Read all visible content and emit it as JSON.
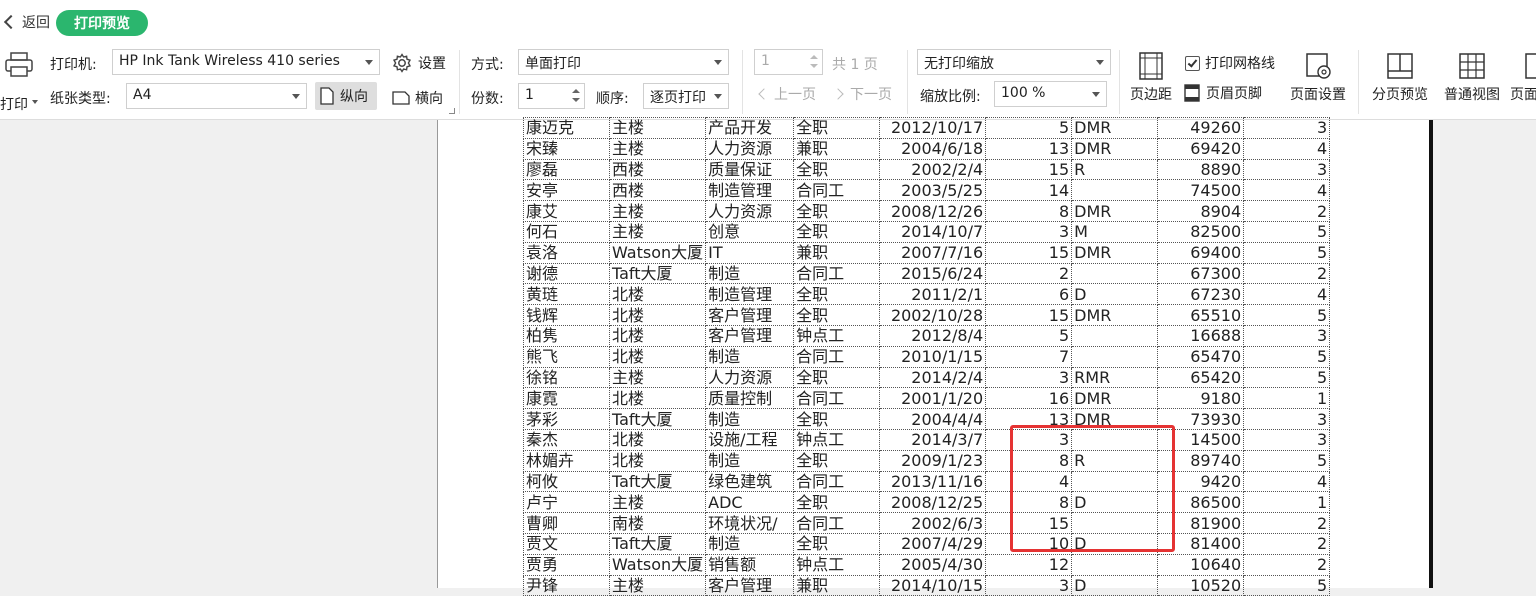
{
  "topbar": {
    "back_label": "返回",
    "mode_label": "打印预览"
  },
  "ribbon": {
    "print_label": "打印",
    "printer_label": "打印机:",
    "printer_value": "HP Ink Tank Wireless 410 series",
    "settings_label": "设置",
    "paper_label": "纸张类型:",
    "paper_value": "A4",
    "portrait_label": "纵向",
    "landscape_label": "横向",
    "method_label": "方式:",
    "method_value": "单面打印",
    "copies_label": "份数:",
    "copies_value": "1",
    "order_label": "顺序:",
    "order_value": "逐页打印",
    "page_value": "1",
    "total_pages": "共 1 页",
    "prev_page": "上一页",
    "next_page": "下一页",
    "scaling_value": "无打印缩放",
    "zoom_label": "缩放比例:",
    "zoom_value": "100 %",
    "margins_label": "页边距",
    "gridlines_label": "打印网格线",
    "header_footer_label": "页眉页脚",
    "page_setup_label": "页面设置",
    "page_break_label": "分页预览",
    "normal_view_label": "普通视图",
    "page_layout_label": "页面"
  },
  "sheet": {
    "rows": [
      [
        "康迈克",
        "主楼",
        "产品开发",
        "全职",
        "2012/10/17",
        "5",
        "DMR",
        "49260",
        "3"
      ],
      [
        "宋臻",
        "主楼",
        "人力资源",
        "兼职",
        "2004/6/18",
        "13",
        "DMR",
        "69420",
        "4"
      ],
      [
        "廖磊",
        "西楼",
        "质量保证",
        "全职",
        "2002/2/4",
        "15",
        "R",
        "8890",
        "3"
      ],
      [
        "安亭",
        "西楼",
        "制造管理",
        "合同工",
        "2003/5/25",
        "14",
        "",
        "74500",
        "4"
      ],
      [
        "康艾",
        "主楼",
        "人力资源",
        "全职",
        "2008/12/26",
        "8",
        "DMR",
        "8904",
        "2"
      ],
      [
        "何石",
        "主楼",
        "创意",
        "全职",
        "2014/10/7",
        "3",
        "M",
        "82500",
        "5"
      ],
      [
        "袁洛",
        "Watson大厦",
        "IT",
        "兼职",
        "2007/7/16",
        "15",
        "DMR",
        "69400",
        "5"
      ],
      [
        "谢德",
        "Taft大厦",
        "制造",
        "合同工",
        "2015/6/24",
        "2",
        "",
        "67300",
        "2"
      ],
      [
        "黄琏",
        "北楼",
        "制造管理",
        "全职",
        "2011/2/1",
        "6",
        "D",
        "67230",
        "4"
      ],
      [
        "钱辉",
        "北楼",
        "客户管理",
        "全职",
        "2002/10/28",
        "15",
        "DMR",
        "65510",
        "5"
      ],
      [
        "柏隽",
        "北楼",
        "客户管理",
        "钟点工",
        "2012/8/4",
        "5",
        "",
        "16688",
        "3"
      ],
      [
        "熊飞",
        "北楼",
        "制造",
        "合同工",
        "2010/1/15",
        "7",
        "",
        "65470",
        "5"
      ],
      [
        "徐铭",
        "主楼",
        "人力资源",
        "全职",
        "2014/2/4",
        "3",
        "RMR",
        "65420",
        "5"
      ],
      [
        "康霓",
        "北楼",
        "质量控制",
        "合同工",
        "2001/1/20",
        "16",
        "DMR",
        "9180",
        "1"
      ],
      [
        "茅彩",
        "Taft大厦",
        "制造",
        "全职",
        "2004/4/4",
        "13",
        "DMR",
        "73930",
        "3"
      ],
      [
        "秦杰",
        "北楼",
        "设施/工程",
        "钟点工",
        "2014/3/7",
        "3",
        "",
        "14500",
        "3"
      ],
      [
        "林媚卉",
        "北楼",
        "制造",
        "全职",
        "2009/1/23",
        "8",
        "R",
        "89740",
        "5"
      ],
      [
        "柯攸",
        "Taft大厦",
        "绿色建筑",
        "合同工",
        "2013/11/16",
        "4",
        "",
        "9420",
        "4"
      ],
      [
        "卢宁",
        "主楼",
        "ADC",
        "全职",
        "2008/12/25",
        "8",
        "D",
        "86500",
        "1"
      ],
      [
        "曹卿",
        "南楼",
        "环境状况/",
        "合同工",
        "2002/6/3",
        "15",
        "",
        "81900",
        "2"
      ],
      [
        "贾文",
        "Taft大厦",
        "制造",
        "全职",
        "2007/4/29",
        "10",
        "D",
        "81400",
        "2"
      ],
      [
        "贾勇",
        "Watson大厦",
        "销售额",
        "钟点工",
        "2005/4/30",
        "12",
        "",
        "10640",
        "2"
      ],
      [
        "尹锋",
        "主楼",
        "客户管理",
        "兼职",
        "2014/10/15",
        "3",
        "D",
        "10520",
        "5"
      ]
    ]
  }
}
